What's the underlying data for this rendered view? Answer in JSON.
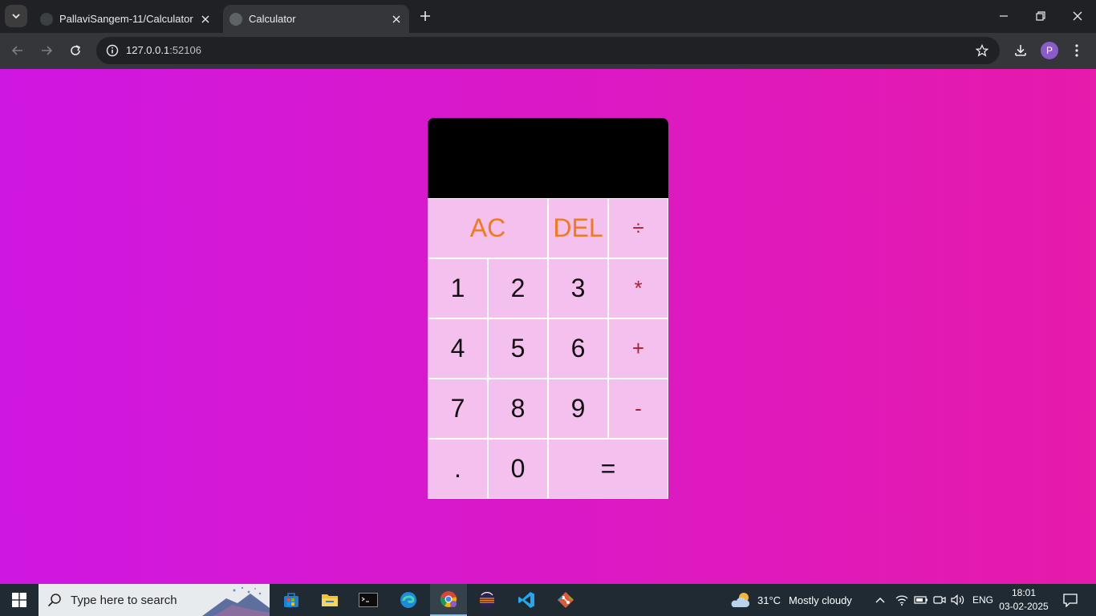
{
  "browser": {
    "tabs": [
      {
        "title": "PallaviSangem-11/Calculator",
        "active": false
      },
      {
        "title": "Calculator",
        "active": true
      }
    ],
    "address": {
      "host": "127.0.0.1",
      "port": ":52106"
    },
    "profile_initial": "P"
  },
  "calculator": {
    "display_value": "",
    "keys": [
      {
        "label": "AC",
        "style": "orange",
        "span": 2
      },
      {
        "label": "DEL",
        "style": "orange",
        "span": 1
      },
      {
        "label": "÷",
        "style": "op",
        "span": 1
      },
      {
        "label": "1",
        "style": "digit",
        "span": 1
      },
      {
        "label": "2",
        "style": "digit",
        "span": 1
      },
      {
        "label": "3",
        "style": "digit",
        "span": 1
      },
      {
        "label": "*",
        "style": "op",
        "span": 1
      },
      {
        "label": "4",
        "style": "digit",
        "span": 1
      },
      {
        "label": "5",
        "style": "digit",
        "span": 1
      },
      {
        "label": "6",
        "style": "digit",
        "span": 1
      },
      {
        "label": "+",
        "style": "op",
        "span": 1
      },
      {
        "label": "7",
        "style": "digit",
        "span": 1
      },
      {
        "label": "8",
        "style": "digit",
        "span": 1
      },
      {
        "label": "9",
        "style": "digit",
        "span": 1
      },
      {
        "label": "-",
        "style": "op",
        "span": 1
      },
      {
        "label": ".",
        "style": "digit",
        "span": 1
      },
      {
        "label": "0",
        "style": "digit",
        "span": 1
      },
      {
        "label": "=",
        "style": "digit",
        "span": 2
      }
    ],
    "colors": {
      "gradient_start": "#cf17e2",
      "gradient_end": "#e61aab",
      "key_bg": "#f4c1ef",
      "key_orange": "#f07b1e",
      "key_op": "#b11e2e"
    }
  },
  "taskbar": {
    "search_placeholder": "Type here to search",
    "apps": [
      "microsoft-store-icon",
      "file-explorer-icon",
      "terminal-icon",
      "edge-icon",
      "chrome-icon",
      "eclipse-icon",
      "vscode-icon",
      "git-icon"
    ],
    "weather": {
      "temp": "31°C",
      "condition": "Mostly cloudy"
    },
    "language": "ENG",
    "time": "18:01",
    "date": "03-02-2025"
  }
}
